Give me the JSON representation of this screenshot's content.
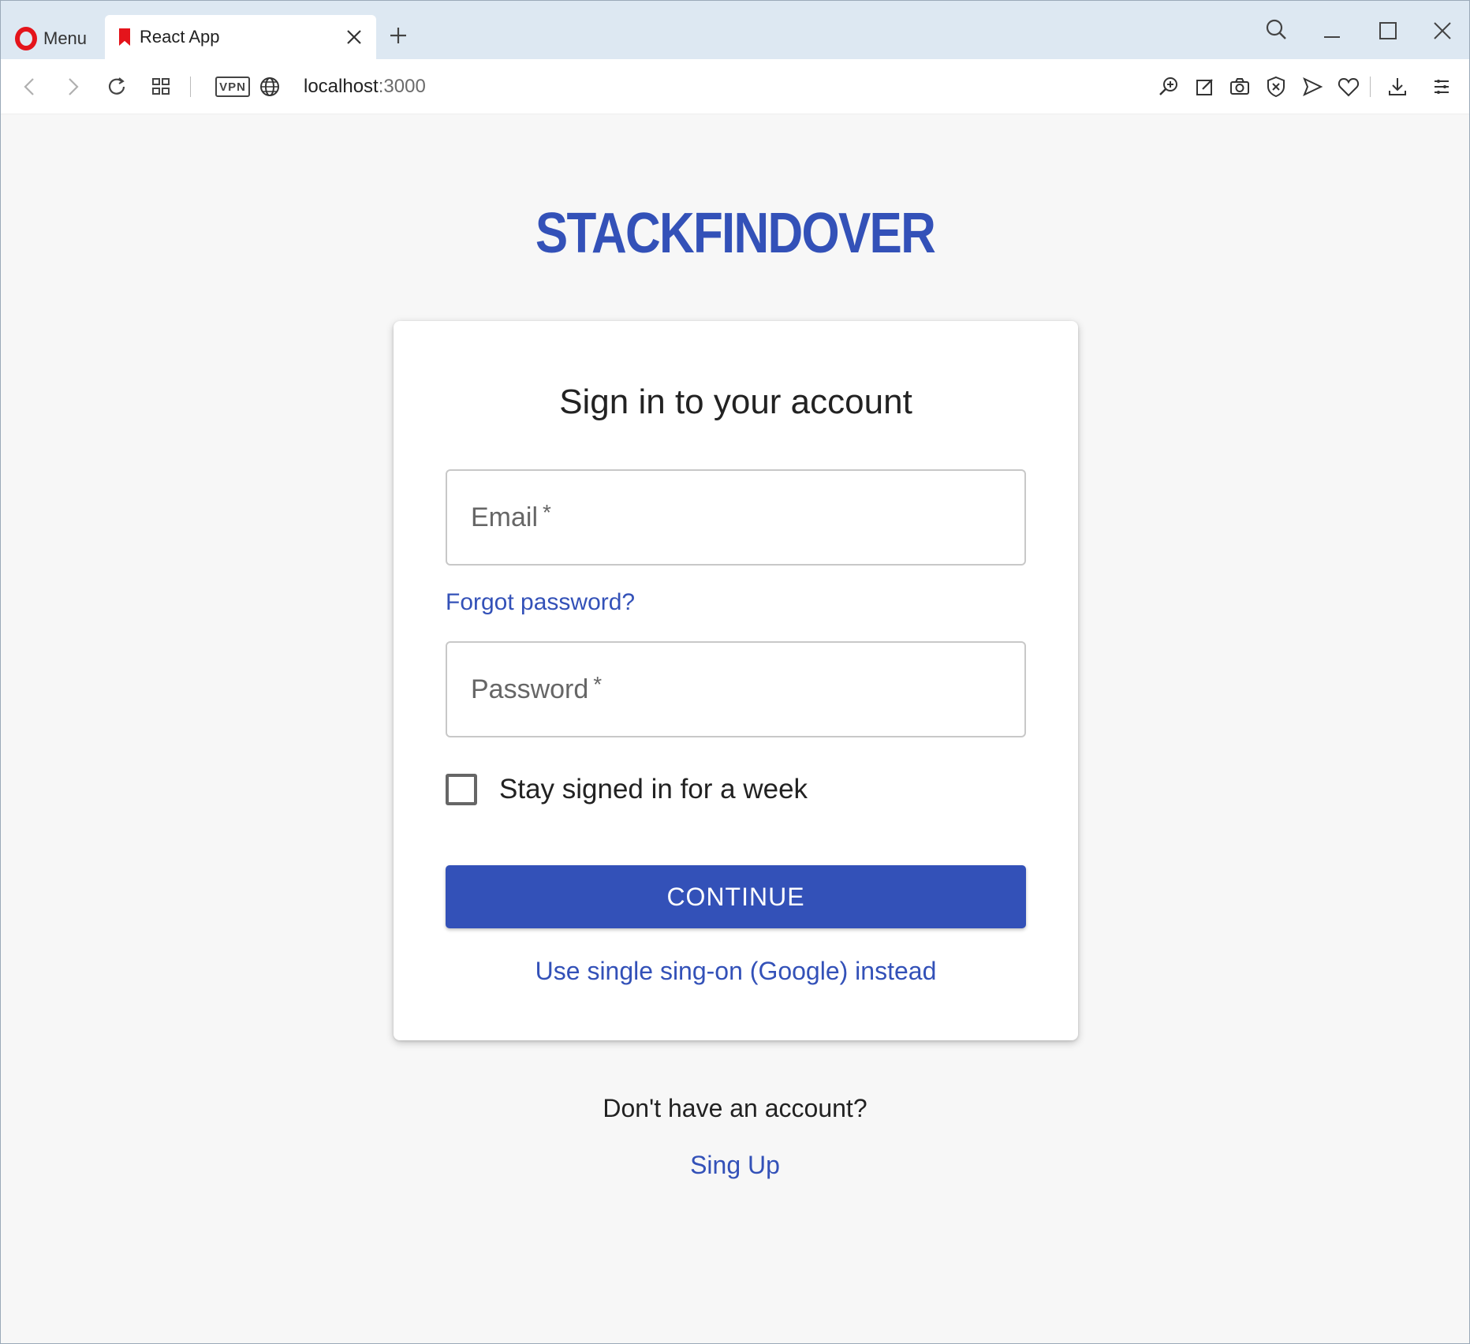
{
  "browser": {
    "menu_label": "Menu",
    "tab_title": "React App",
    "address": {
      "host": "localhost",
      "port": ":3000"
    },
    "vpn_label": "VPN"
  },
  "app": {
    "brand": "STACKFINDOVER"
  },
  "signin": {
    "title": "Sign in to your account",
    "email_label": "Email",
    "password_label": "Password",
    "required_mark": "*",
    "forgot_link": "Forgot password?",
    "stay_signed_label": "Stay signed in for a week",
    "stay_signed_checked": false,
    "continue_label": "CONTINUE",
    "sso_link": "Use single sing-on (Google) instead"
  },
  "footer": {
    "no_account_text": "Don't have an account?",
    "signup_link": "Sing Up"
  },
  "colors": {
    "accent": "#3351b8",
    "opera_red": "#e4141b",
    "page_bg": "#f7f7f7",
    "tabbar_bg": "#dde8f2"
  }
}
